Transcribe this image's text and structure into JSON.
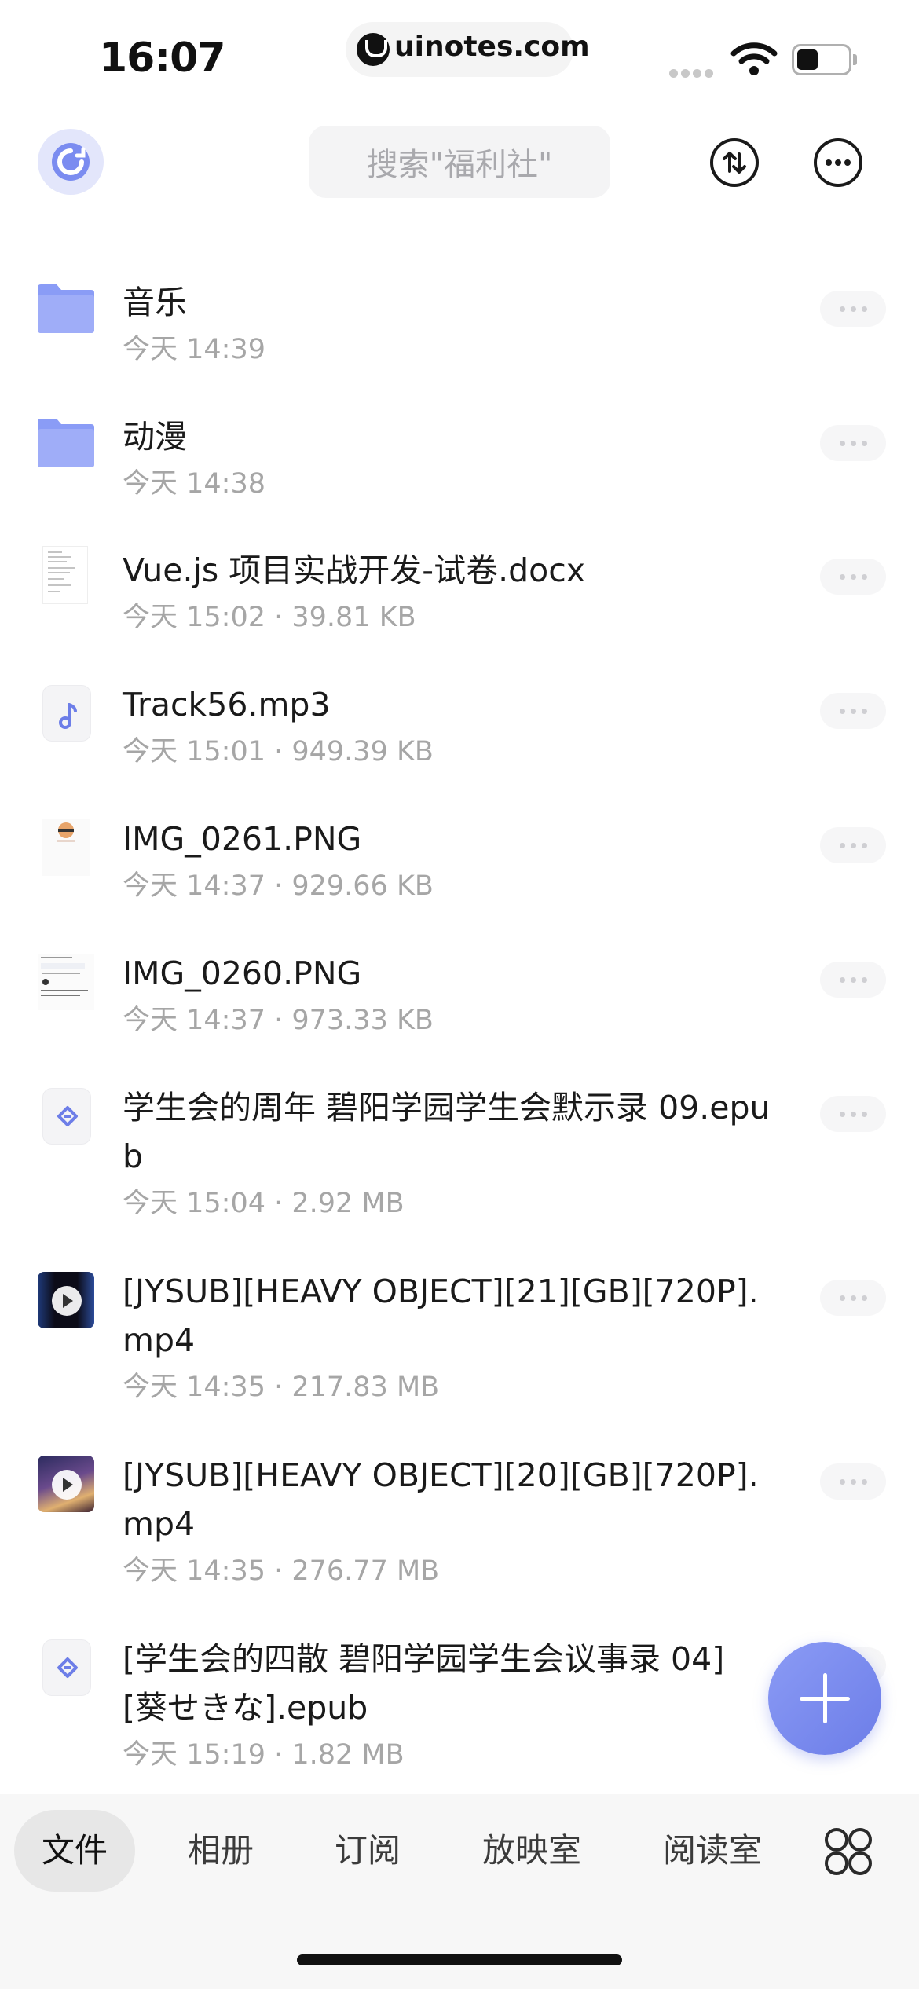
{
  "status_bar": {
    "time": "16:07",
    "url": "uinotes.com"
  },
  "header": {
    "search_placeholder": "搜索\"福利社\"",
    "logo_icon": "sync-cloud-icon",
    "sort_icon": "sort-arrows-icon",
    "more_icon": "more-horizontal-icon"
  },
  "files": [
    {
      "name": "音乐",
      "meta": "今天 14:39",
      "type": "folder"
    },
    {
      "name": "动漫",
      "meta": "今天 14:38",
      "type": "folder"
    },
    {
      "name": "Vue.js 项目实战开发-试卷.docx",
      "meta": "今天 15:02 · 39.81 KB",
      "type": "docx"
    },
    {
      "name": "Track56.mp3",
      "meta": "今天 15:01 · 949.39 KB",
      "type": "audio"
    },
    {
      "name": "IMG_0261.PNG",
      "meta": "今天 14:37 · 929.66 KB",
      "type": "image"
    },
    {
      "name": "IMG_0260.PNG",
      "meta": "今天 14:37 · 973.33 KB",
      "type": "image"
    },
    {
      "name": "学生会的周年 碧阳学园学生会默示录 09.epub",
      "meta": "今天 15:04 · 2.92 MB",
      "type": "epub"
    },
    {
      "name": "[JYSUB][HEAVY OBJECT][21][GB][720P].mp4",
      "meta": "今天 14:35 · 217.83 MB",
      "type": "video"
    },
    {
      "name": "[JYSUB][HEAVY OBJECT][20][GB][720P].mp4",
      "meta": "今天 14:35 · 276.77 MB",
      "type": "video"
    },
    {
      "name": "[学生会的四散 碧阳学园学生会议事录 04][葵せきな].epub",
      "meta": "今天 15:19 · 1.82 MB",
      "type": "epub"
    }
  ],
  "bottom_nav": {
    "tabs": [
      "文件",
      "相册",
      "订阅",
      "放映室",
      "阅读室"
    ],
    "active": "文件",
    "apps_icon": "apps-grid-icon"
  },
  "colors": {
    "accent": "#7b8cf0",
    "folder": "#8a9cf6",
    "meta_text": "#a6a6a6"
  }
}
